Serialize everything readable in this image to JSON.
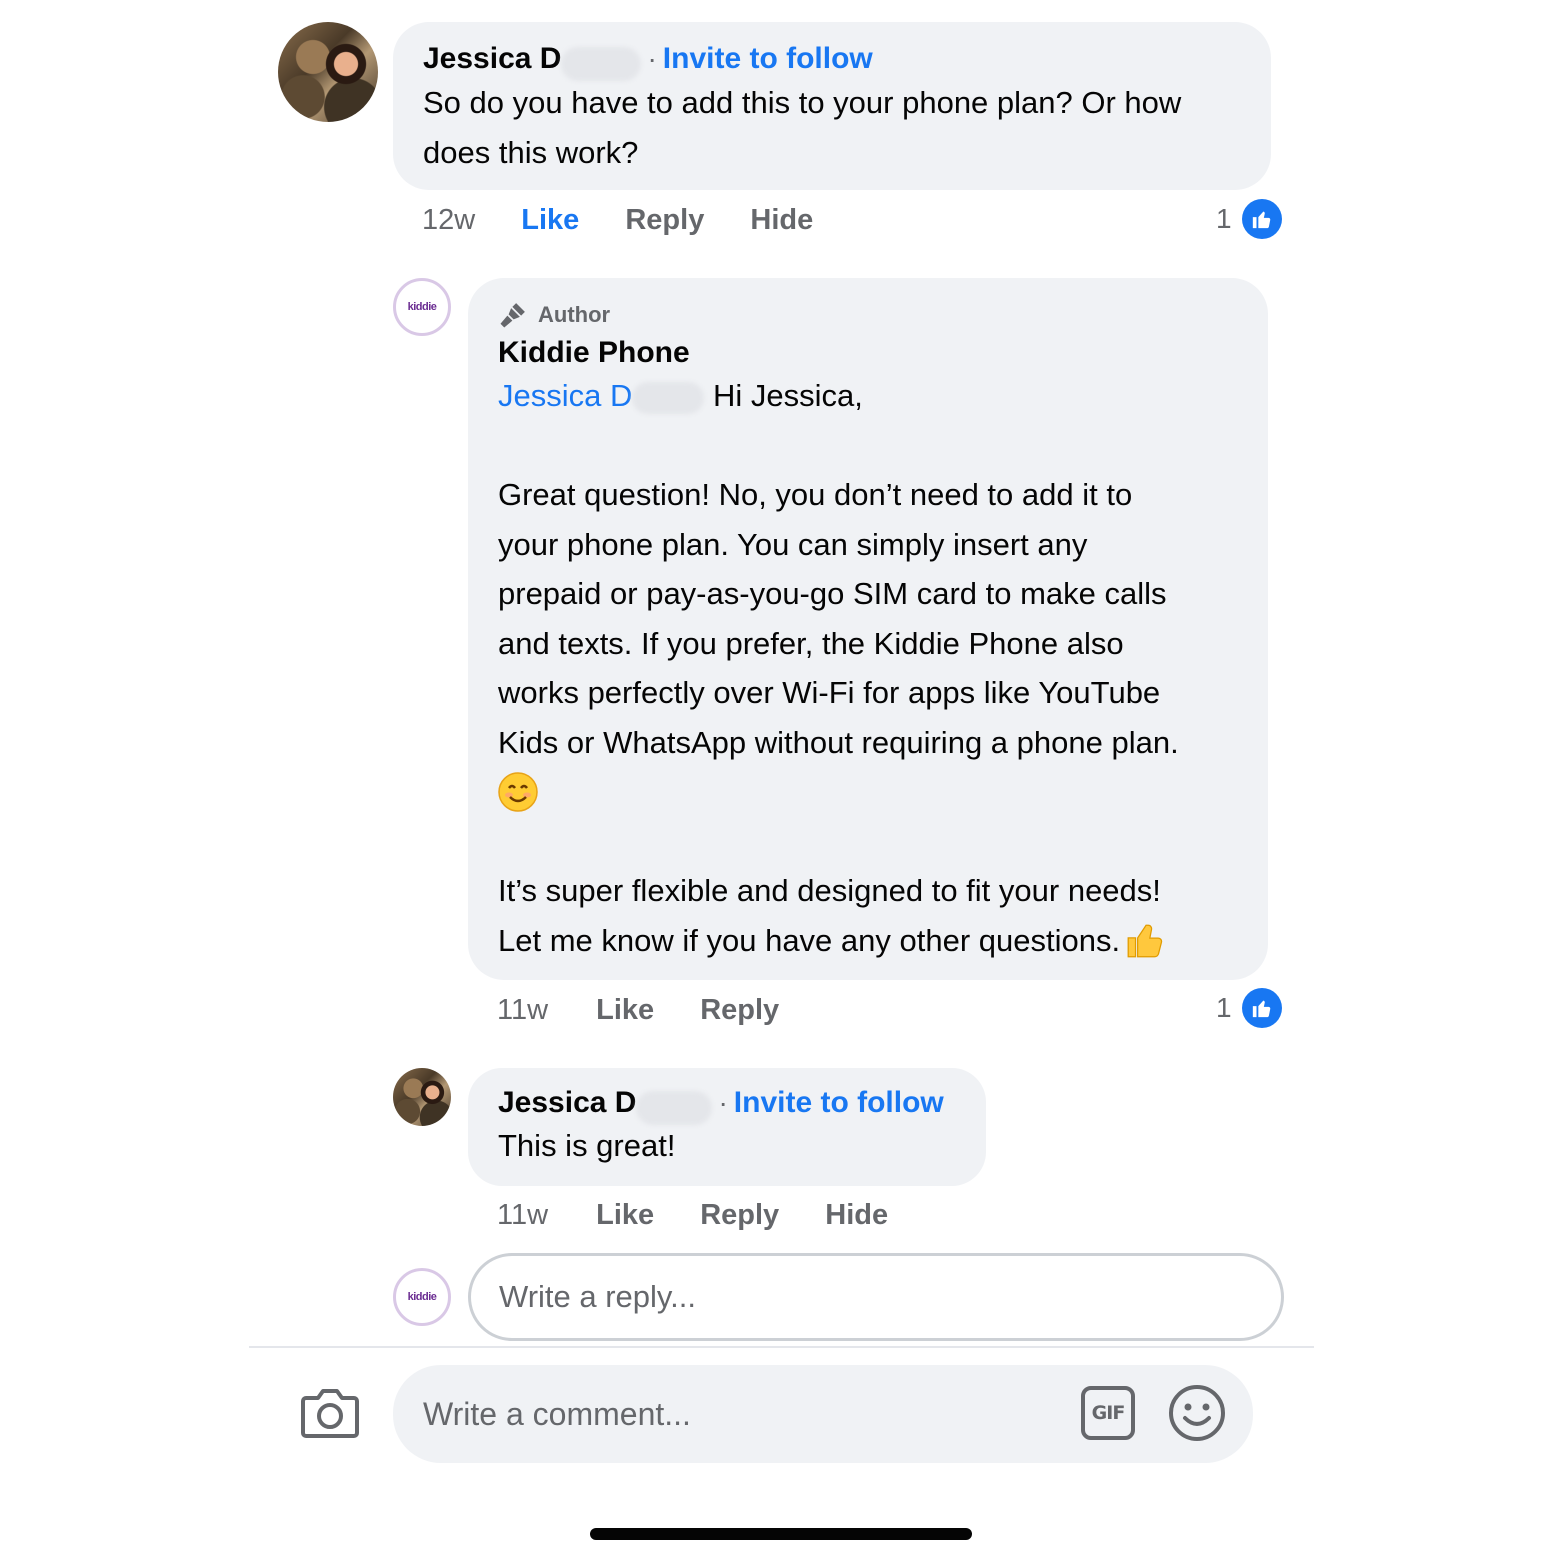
{
  "comment1": {
    "author_visible": "Jessica D",
    "separator": "·",
    "invite_label": "Invite to follow",
    "text_line1": "So do you have to add this to your phone plan? Or how",
    "text_line2": "does this work?",
    "time": "12w",
    "like_label": "Like",
    "reply_label": "Reply",
    "hide_label": "Hide",
    "like_count": "1"
  },
  "reply1": {
    "badge_label": "Author",
    "author": "Kiddie Phone",
    "avatar_text": "kiddie",
    "mention_visible": "Jessica D",
    "greeting": "Hi Jessica,",
    "paragraph1_lines": [
      "Great question! No, you don’t need to add it to",
      "your phone plan. You can simply insert any",
      "prepaid or pay-as-you-go SIM card to make calls",
      "and texts. If you prefer, the Kiddie Phone also",
      "works perfectly over Wi-Fi for apps like YouTube",
      "Kids or WhatsApp without requiring a phone plan."
    ],
    "smile_emoji": "😊",
    "paragraph2_line1": "It’s super flexible and designed to fit your needs!",
    "paragraph2_line2": "Let me know if you have any other questions.",
    "thumbs_emoji": "👍",
    "time": "11w",
    "like_label": "Like",
    "reply_label": "Reply",
    "like_count": "1"
  },
  "reply2": {
    "author_visible": "Jessica D",
    "separator": "·",
    "invite_label": "Invite to follow",
    "text": "This is great!",
    "time": "11w",
    "like_label": "Like",
    "reply_label": "Reply",
    "hide_label": "Hide"
  },
  "reply_input": {
    "placeholder": "Write a reply...",
    "avatar_text": "kiddie"
  },
  "comment_input": {
    "placeholder": "Write a comment...",
    "gif_label": "GIF"
  },
  "colors": {
    "accent": "#1877f2",
    "bubble": "#f0f2f5",
    "secondary_text": "#65676b"
  }
}
